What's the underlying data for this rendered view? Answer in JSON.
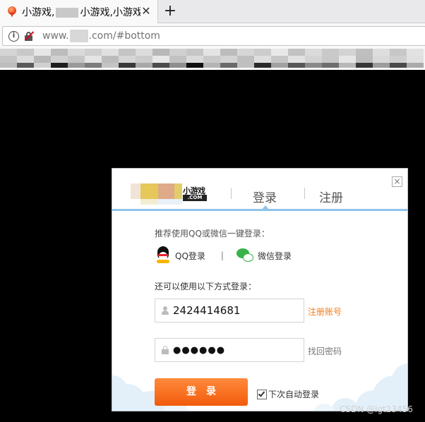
{
  "browser": {
    "tab_title_part1": "小游戏,",
    "tab_title_part2": "小游戏,小游戏",
    "close_tab": "✕",
    "new_tab": "+",
    "url_prefix": "www.",
    "url_suffix": ".com/#bottom"
  },
  "dialog": {
    "logo_text": "小游戏",
    "logo_com": ".COM",
    "tab_login": "登录",
    "tab_register": "注册",
    "close": "×",
    "recommend_label": "推荐使用QQ或微信一键登录：",
    "qq_login": "QQ登录",
    "separator": "|",
    "wechat_login": "微信登录",
    "alt_label": "还可以使用以下方式登录：",
    "username_value": "2424414681",
    "password_mask": "●●●●●●",
    "register_account": "注册账号",
    "forgot_password": "找回密码",
    "login_button": "登录",
    "auto_login": "下次自动登录",
    "auto_login_checked": true
  },
  "watermark": "CSDN @lgt23456",
  "colors": {
    "accent_orange": "#f25b0c",
    "header_blue": "#8fc3ea",
    "link_orange": "#f57b16"
  }
}
